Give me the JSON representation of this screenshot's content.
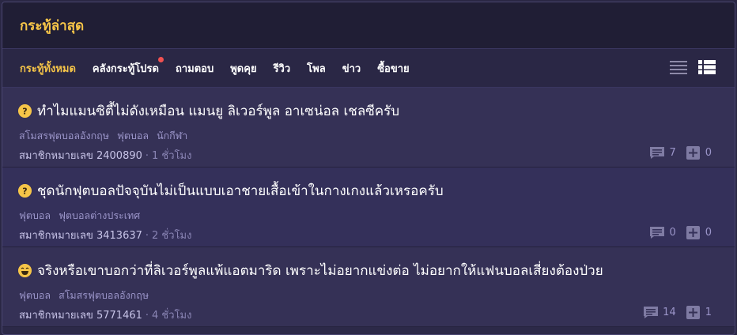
{
  "header": {
    "title": "กระทู้ล่าสุด"
  },
  "tabs": [
    {
      "label": "กระทู้ทั้งหมด",
      "active": true
    },
    {
      "label": "คลังกระทู้โปรด",
      "badge": true
    },
    {
      "label": "ถามตอบ"
    },
    {
      "label": "พูดคุย"
    },
    {
      "label": "รีวิว"
    },
    {
      "label": "โพล"
    },
    {
      "label": "ข่าว"
    },
    {
      "label": "ซื้อขาย"
    }
  ],
  "view_toggles": [
    "list-view-icon",
    "card-view-icon"
  ],
  "topics": [
    {
      "emoticon": "question-emoticon-icon",
      "title": "ทำไมแมนซิตี้ไม่ดังเหมือน แมนยู ลิเวอร์พูล อาเซน่อล เชลซีครับ",
      "tags": [
        "สโมสรฟุตบอลอังกฤษ",
        "ฟุตบอล",
        "นักกีฬา"
      ],
      "author": "สมาชิกหมายเลข 2400890",
      "time": "1 ชั่วโมง",
      "comments": "7",
      "votes": "0"
    },
    {
      "emoticon": "question-emoticon-icon",
      "title": "ชุดนักฟุตบอลปัจจุบันไม่เป็นแบบเอาชายเสื้อเข้าในกางเกงแล้วเหรอครับ",
      "tags": [
        "ฟุตบอล",
        "ฟุตบอลต่างประเทศ"
      ],
      "author": "สมาชิกหมายเลข 3413637",
      "time": "2 ชั่วโมง",
      "comments": "0",
      "votes": "0"
    },
    {
      "emoticon": "laugh-emoticon-icon",
      "title": "จริงหรือเขาบอกว่าที่ลิเวอร์พูลแพ้แอตมาริด เพราะไม่อยากแข่งต่อ ไม่อยากให้แฟนบอลเสี่ยงต้องป่วย",
      "tags": [
        "ฟุตบอล",
        "สโมสรฟุตบอลอังกฤษ"
      ],
      "author": "สมาชิกหมายเลข 5771461",
      "time": "4 ชั่วโมง",
      "comments": "14",
      "votes": "1"
    }
  ],
  "colors": {
    "accent": "#f6c548",
    "header_bg": "#201e35",
    "row_bg": "#353156",
    "tag": "#9b95c9",
    "badge": "#f25151"
  }
}
